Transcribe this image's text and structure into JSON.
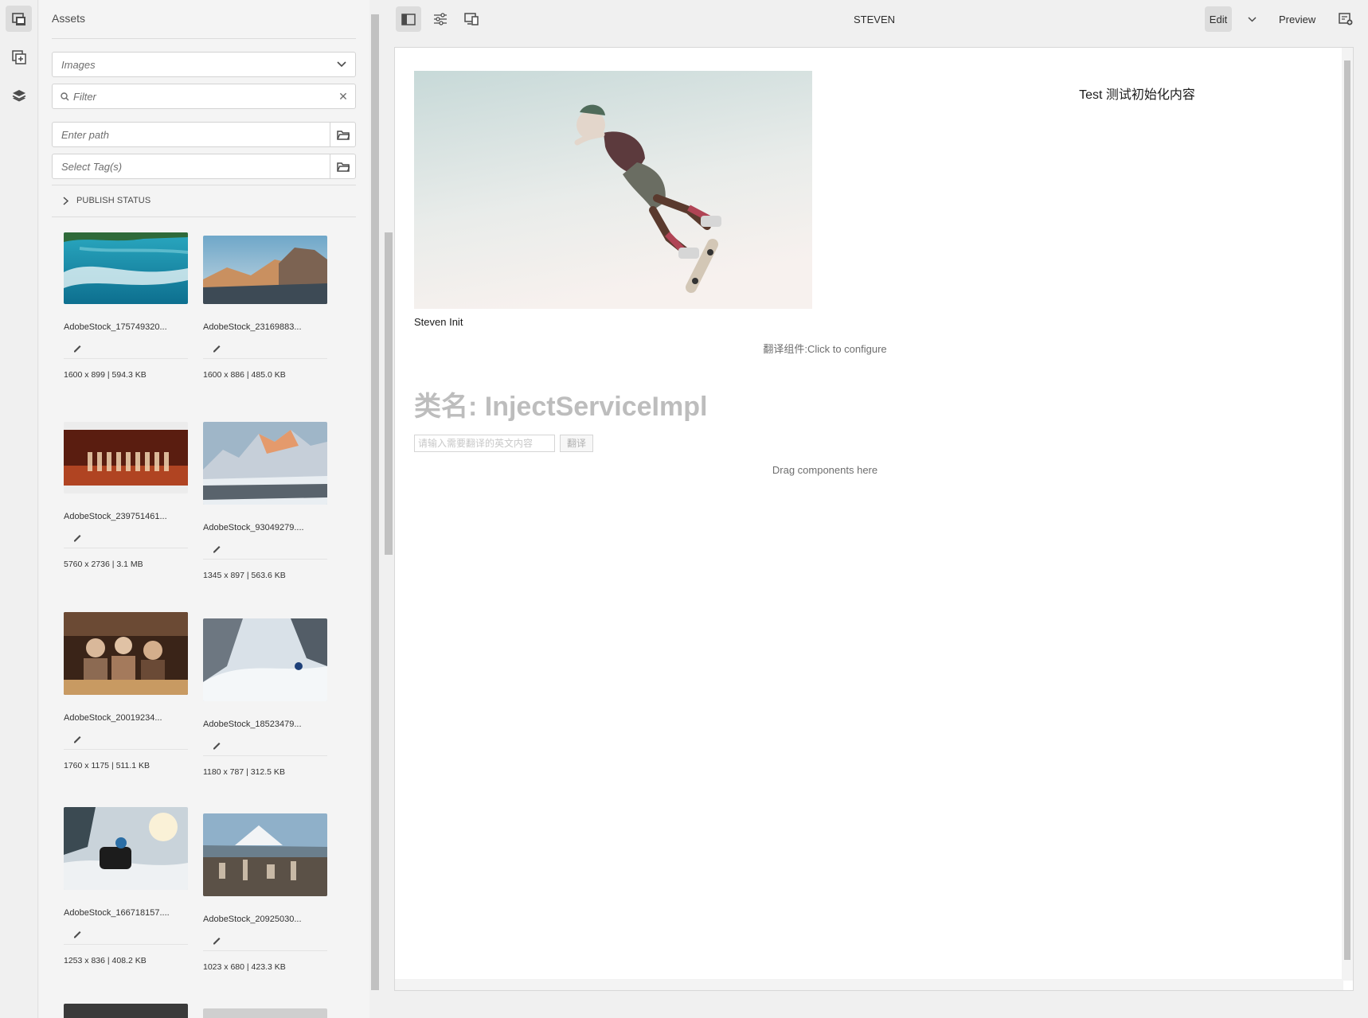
{
  "rail": {
    "items": [
      "assets-icon",
      "components-icon",
      "layers-icon"
    ]
  },
  "panel": {
    "title": "Assets",
    "asset_type": "Images",
    "filter_placeholder": "Filter",
    "path_placeholder": "Enter path",
    "tags_placeholder": "Select Tag(s)",
    "publish_status": "PUBLISH STATUS",
    "assets": [
      {
        "name": "AdobeStock_175749320...",
        "meta": "1600 x 899 | 594.3 KB",
        "thumb": "surf-wave"
      },
      {
        "name": "AdobeStock_23169883...",
        "meta": "1600 x 886 | 485.0 KB",
        "thumb": "mountain-cliff"
      },
      {
        "name": "AdobeStock_239751461...",
        "meta": "5760 x 2736 | 3.1 MB",
        "thumb": "wine-glasses"
      },
      {
        "name": "AdobeStock_93049279....",
        "meta": "1345 x 897 | 563.6 KB",
        "thumb": "snowy-peaks"
      },
      {
        "name": "AdobeStock_20019234...",
        "meta": "1760 x 1175 | 511.1 KB",
        "thumb": "friends-cafe"
      },
      {
        "name": "AdobeStock_18523479...",
        "meta": "1180 x 787 | 312.5 KB",
        "thumb": "skier-powder"
      },
      {
        "name": "AdobeStock_166718157....",
        "meta": "1253 x 836 | 408.2 KB",
        "thumb": "snowmobile"
      },
      {
        "name": "AdobeStock_20925030...",
        "meta": "1023 x 680 | 423.3 KB",
        "thumb": "city-skyline"
      }
    ]
  },
  "topbar": {
    "title": "STEVEN",
    "edit_label": "Edit",
    "preview_label": "Preview"
  },
  "canvas": {
    "image_caption": "Steven Init",
    "heading": "Test 测试初始化内容",
    "configure_text": "翻译组件:Click to configure",
    "class_label": "类名: InjectServiceImpl",
    "translate_placeholder": "请输入需要翻译的英文内容",
    "translate_button": "翻译",
    "drag_hint": "Drag components here"
  }
}
